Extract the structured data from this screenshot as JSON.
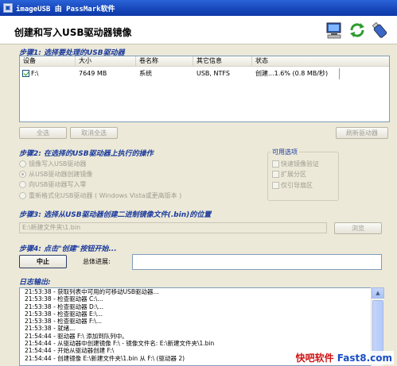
{
  "window": {
    "title": "imageUSB 由 PassMark软件"
  },
  "header": {
    "title": "创建和写入USB驱动器镜像"
  },
  "step1": {
    "title": "步骤1: 选择要处理的USB驱动器",
    "columns": [
      "设备",
      "大小",
      "卷名称",
      "其它信息",
      "状态"
    ],
    "rows": [
      {
        "checked": true,
        "device": "F:\\",
        "size": "7649 MB",
        "volume": "系统",
        "info": "USB, NTFS",
        "status": "创建...1.6% (0.8 MB/秒)"
      }
    ],
    "select_all": "全选",
    "deselect_all": "取消全选",
    "refresh": "刷新驱动器"
  },
  "step2": {
    "title": "步骤2: 在选择的USB驱动器上执行的操作",
    "options": [
      {
        "label": "镜像写入USB驱动器",
        "selected": false
      },
      {
        "label": "从USB驱动器创建镜像",
        "selected": true
      },
      {
        "label": "向USB驱动器写入零",
        "selected": false
      },
      {
        "label": "重新格式化USB驱动器 ( Windows Vista或更高版本 )",
        "selected": false
      }
    ],
    "available_title": "可用选项",
    "available": [
      {
        "label": "快速镜像验证",
        "checked": false
      },
      {
        "label": "扩展分区",
        "checked": false
      },
      {
        "label": "仅引导扇区",
        "checked": false
      }
    ]
  },
  "step3": {
    "title": "步骤3: 选择从USB驱动器创建二进制镜像文件(.bin)的位置",
    "path": "E:\\新建文件夹\\1.bin",
    "browse": "浏览"
  },
  "step4": {
    "title": "步骤4: 点击\"创建\"按钮开始...",
    "stop": "中止",
    "progress_label": "总体进展:"
  },
  "log": {
    "title": "日志输出:",
    "lines": [
      "21:53:38 - 获取列表中可用的可移动USB驱动器...",
      "21:53:38 - 检查驱动器 C:\\...",
      "21:53:38 - 检查驱动器 D:\\...",
      "21:53:38 - 检查驱动器 E:\\...",
      "21:53:38 - 检查驱动器 F:\\...",
      "21:53:38 - 就绪...",
      "21:54:44 - 驱动器 F:\\ 添加到队列中。",
      "21:54:44 - 从驱动器中创建镜像 F:\\ - 镜像文件名: E:\\新建文件夹\\1.bin",
      "21:54:44 - 开始从驱动器创建 F:\\",
      "21:54:44 - 创建镜像 E:\\新建文件夹\\1.bin 从 F:\\ (驱动器 2)"
    ]
  },
  "watermark": {
    "part1": "快吧软件 ",
    "part2": "Fast8.com"
  }
}
